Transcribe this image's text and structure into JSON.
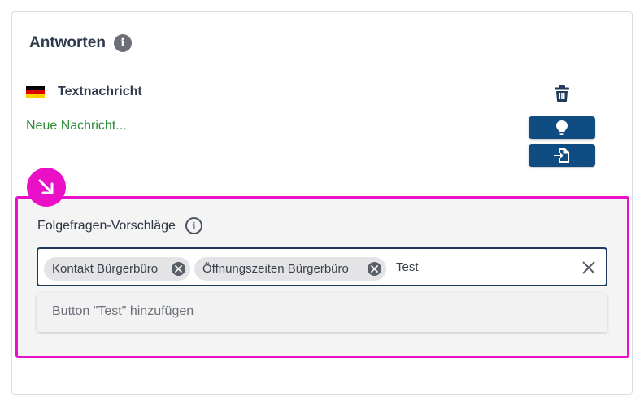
{
  "section": {
    "title": "Antworten",
    "info_icon": "info-icon"
  },
  "message": {
    "flag": "germany-flag",
    "type_label": "Textnachricht",
    "text": "Neue Nachricht...",
    "delete_icon": "trash-icon",
    "buttons": [
      {
        "icon": "lightbulb-icon"
      },
      {
        "icon": "file-import-icon"
      }
    ]
  },
  "followups": {
    "title": "Folgefragen-Vorschläge",
    "info_icon": "info-outline-icon",
    "chips": [
      {
        "label": "Kontakt Bürgerbüro"
      },
      {
        "label": "Öffnungszeiten Bürgerbüro"
      }
    ],
    "input_value": "Test",
    "suggestion": "Button \"Test\" hinzufügen"
  },
  "annotation": {
    "icon": "arrow-down-right-icon",
    "color": "#ea10c8"
  },
  "colors": {
    "primary": "#0f4c81",
    "link_green": "#2e8b3a",
    "highlight": "#ea10c8"
  }
}
